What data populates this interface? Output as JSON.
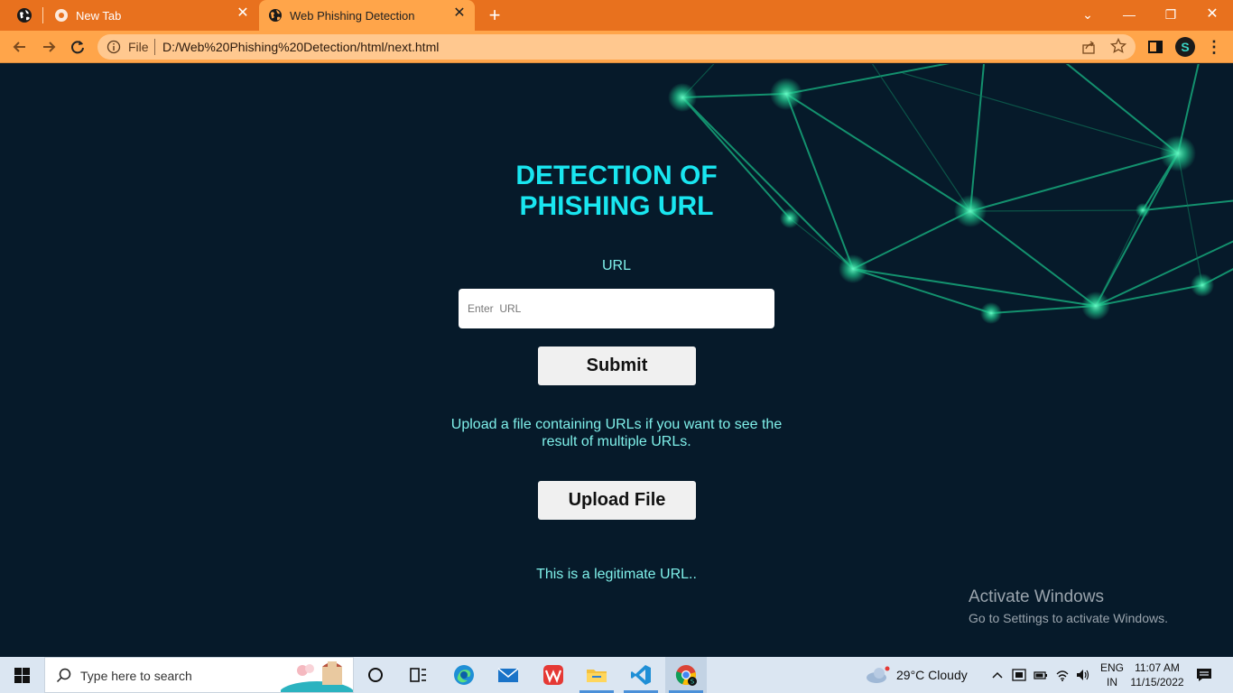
{
  "browser": {
    "tabs": [
      {
        "title": "New Tab",
        "active": false
      },
      {
        "title": "Web Phishing Detection",
        "active": true
      }
    ],
    "address": {
      "scheme_label": "File",
      "url": "D:/Web%20Phishing%20Detection/html/next.html"
    },
    "profile_initial": "S"
  },
  "page": {
    "heading_line1": "DETECTION OF",
    "heading_line2": "PHISHING URL",
    "url_label": "URL",
    "url_input_placeholder": "Enter  URL",
    "url_input_value": "",
    "submit_label": "Submit",
    "upload_text": "Upload a file containing URLs if you want to see the result of multiple URLs.",
    "upload_label": "Upload File",
    "result_text": "This is a legitimate URL..",
    "accent_color": "#19e6f0",
    "text_color": "#7ff0ea",
    "background_color": "#061a2a"
  },
  "watermark": {
    "title": "Activate Windows",
    "subtitle": "Go to Settings to activate Windows."
  },
  "taskbar": {
    "search_placeholder": "Type here to search",
    "weather": "29°C  Cloudy",
    "lang_line1": "ENG",
    "lang_line2": "IN",
    "time": "11:07 AM",
    "date": "11/15/2022",
    "apps": [
      "cortana-icon",
      "task-view-icon",
      "edge-icon",
      "mail-icon",
      "wps-icon",
      "file-explorer-icon",
      "vscode-icon",
      "chrome-icon"
    ]
  }
}
